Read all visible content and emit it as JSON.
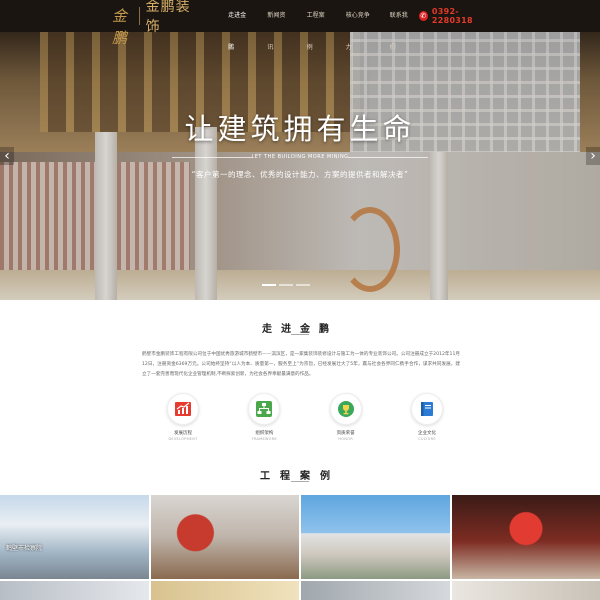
{
  "header": {
    "logo_mark": "金鹏",
    "logo_text": "金鹏装饰",
    "nav": [
      {
        "label": "走进金鹏",
        "active": true
      },
      {
        "label": "新闻资讯",
        "active": false
      },
      {
        "label": "工程案例",
        "active": false
      },
      {
        "label": "核心竞争力",
        "active": false
      },
      {
        "label": "联系我们",
        "active": false
      }
    ],
    "phone_icon": "phone-icon",
    "phone": "0392-2280318"
  },
  "banner": {
    "title": "让建筑拥有生命",
    "subtitle_en": "LET THE BUILDING MORE MINING",
    "subtitle_cn": "“客户第一的理念、优秀的设计能力、方案的提供者和解决者”",
    "prev_icon": "‹",
    "next_icon": "›",
    "slides_count": 3,
    "active_slide": 1
  },
  "about": {
    "title": "走进金鹏",
    "text": "鹤壁市金鹏装饰工程有限公司位于中国优秀旅游城市鹤壁市——淇滨区，是一家集装饰装修设计与施工为一体的专业装饰公司。公司注册成立于2012年11月12日，注册资金6369万元。公司始终坚持“以人为本、质量第一，服务至上”为宗旨，已经发展壮大了5年，赢与社会各界同仁携手合作，谋求共同发展，建立了一套完善而现代化企业管理机制,不断探索创新，为社会各界奉献最满意的作品。",
    "features": [
      {
        "label": "发展历程",
        "en": "DEVELOPMENT",
        "icon": "growth-chart-icon"
      },
      {
        "label": "组织架构",
        "en": "FRAMEWORK",
        "icon": "org-chart-icon"
      },
      {
        "label": "资质荣誉",
        "en": "HONOR",
        "icon": "trophy-icon"
      },
      {
        "label": "企业文化",
        "en": "CULTURE",
        "icon": "book-icon"
      }
    ]
  },
  "cases": {
    "title": "工程案例",
    "items": [
      {
        "caption": "鹤壁市检察院"
      },
      {
        "caption": ""
      },
      {
        "caption": ""
      },
      {
        "caption": ""
      }
    ]
  },
  "colors": {
    "header_bg": "#1a1510",
    "gold": "#d7b06a",
    "phone_red": "#e23a2a",
    "accent_red": "#e63b2e",
    "accent_green": "#4aa84a",
    "accent_blue": "#2b7bd4"
  }
}
